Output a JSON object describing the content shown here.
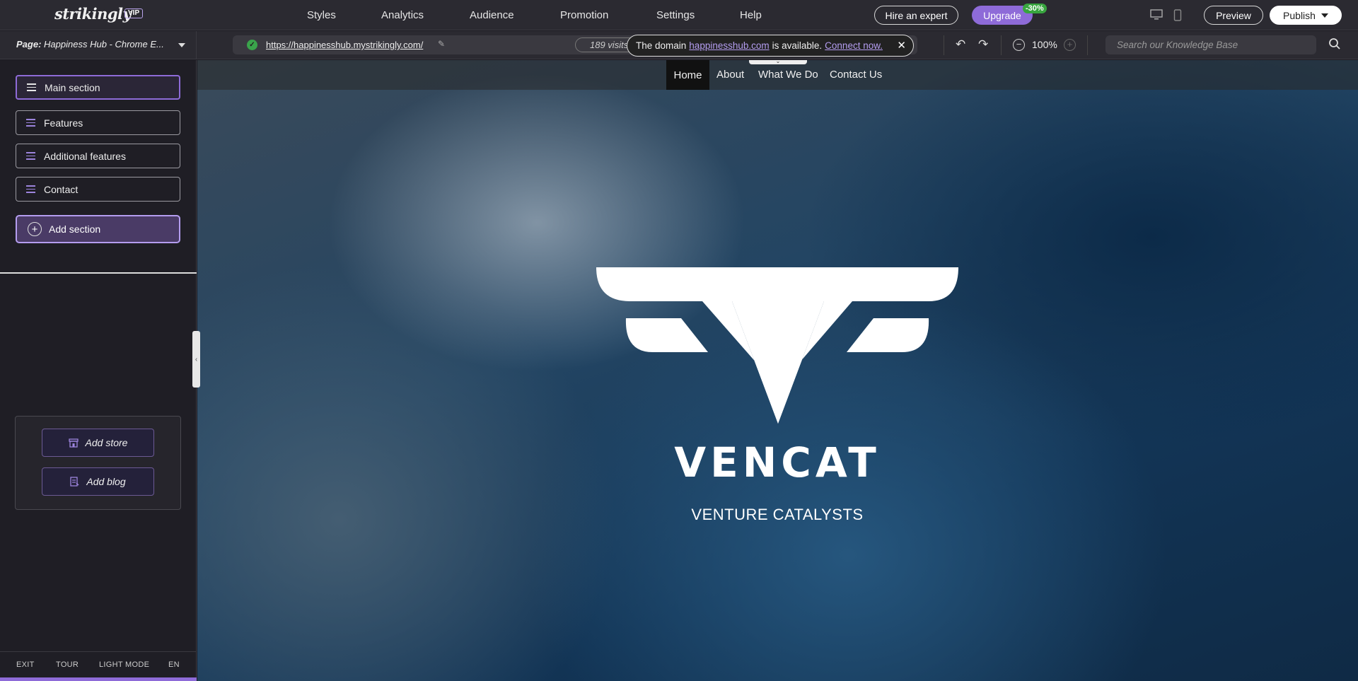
{
  "app": {
    "logo": "strikingly",
    "vip_badge": "VIP"
  },
  "topnav": {
    "items": [
      "Styles",
      "Analytics",
      "Audience",
      "Promotion",
      "Settings",
      "Help"
    ],
    "hire_expert": "Hire an expert",
    "upgrade": "Upgrade",
    "discount_badge": "-30%",
    "preview": "Preview",
    "publish": "Publish"
  },
  "subbar": {
    "page_label": "Page:",
    "page_name": "Happiness Hub - Chrome E...",
    "url": "https://happinesshub.mystrikingly.com/",
    "visits": "189 visits",
    "domain_notice": {
      "prefix": "The domain",
      "domain": "happinesshub.com",
      "middle": "is available.",
      "action": "Connect now."
    },
    "zoom": "100%",
    "search_placeholder": "Search our Knowledge Base"
  },
  "sidebar": {
    "sections": [
      "Main section",
      "Features",
      "Additional features",
      "Contact"
    ],
    "add_section": "Add section",
    "add_store": "Add store",
    "add_blog": "Add blog",
    "footer": [
      "EXIT",
      "TOUR",
      "LIGHT MODE",
      "EN"
    ]
  },
  "site": {
    "nav": [
      "Home",
      "About",
      "What We Do",
      "Contact Us"
    ],
    "title": "VENCAT",
    "subtitle": "VENTURE CATALYSTS"
  },
  "colors": {
    "accent": "#8e6bd8",
    "success": "#38a53f",
    "topbar_bg": "#2b2a31"
  }
}
